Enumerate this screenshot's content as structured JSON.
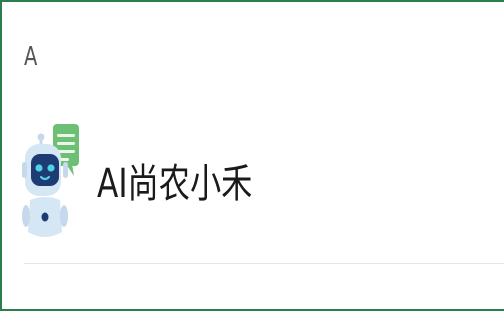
{
  "contacts": {
    "section_index": "A",
    "items": [
      {
        "name": "AI尚农小禾",
        "avatar_icon": "ai-robot-chat-icon"
      }
    ]
  },
  "colors": {
    "frame_border": "#2e7d4f",
    "chat_bubble": "#6dbf73",
    "robot_face": "#1f3b73",
    "robot_eyes": "#4fd1e8",
    "robot_body": "#d5e6f5"
  }
}
